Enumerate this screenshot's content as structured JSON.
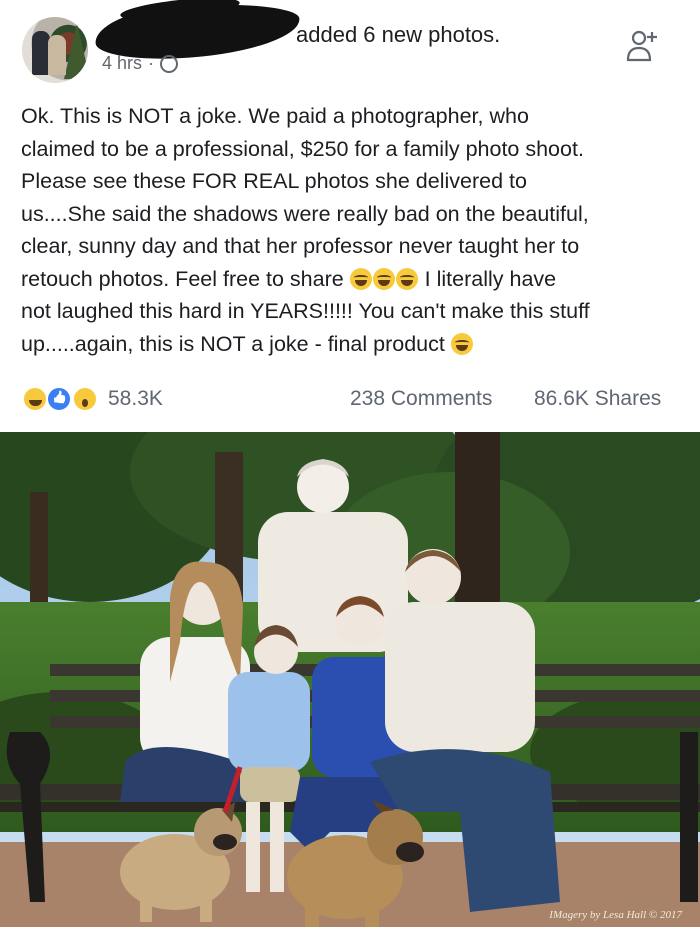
{
  "post": {
    "headline": "added 6 new photos.",
    "time": "4 hrs",
    "separator": "·",
    "text_lines": [
      "Ok.  This is NOT a joke.  We paid a photographer, who",
      "claimed to be a professional, $250 for a family photo shoot.",
      "Please see these FOR REAL photos she delivered to",
      "us....She said the shadows were really bad on the beautiful,",
      "clear, sunny day and that her professor never taught her to",
      "retouch photos.  Feel free to share",
      "I literally have",
      "not laughed this hard in YEARS!!!!!  You can't make this stuff",
      "up.....again, this is NOT a joke - final product"
    ],
    "reactions_count": "58.3K",
    "comments": "238 Comments",
    "shares": "86.6K Shares"
  },
  "photo": {
    "watermark": "IMagery by Lesa Hall © 2017"
  },
  "icons": {
    "globe": "globe-icon",
    "add_friend": "add-friend-icon",
    "reactions": [
      "haha-icon",
      "like-icon",
      "wow-icon"
    ]
  },
  "colors": {
    "text": "#1c1e21",
    "meta": "#606770",
    "like_blue": "#3b7ff5",
    "emoji_yellow": "#f7c93c"
  }
}
